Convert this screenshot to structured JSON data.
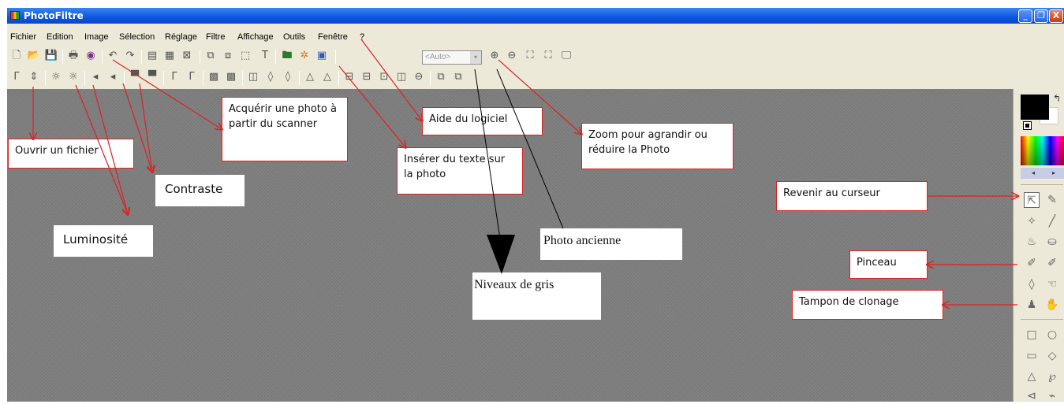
{
  "window": {
    "title": "PhotoFiltre",
    "minimize_label": "_",
    "maximize_label": "❐",
    "close_label": "X"
  },
  "menu": [
    "Fichier",
    "Edition",
    "Image",
    "Sélection",
    "Réglage",
    "Filtre",
    "Affichage",
    "Outils",
    "Fenêtre",
    "?"
  ],
  "toolbar": {
    "zoom_value": "<Auto>",
    "zoom_arrow": "▾"
  },
  "tool_panel": {
    "swap_glyph": "↰",
    "nav_left": "◂",
    "nav_right": "▸"
  },
  "annotations": {
    "ouvrir": "Ouvrir un fichier",
    "luminosite": "Luminosité",
    "contraste": "Contraste",
    "acquerir": "Acquérir une photo à partir du scanner",
    "inserer": "Insérer du texte sur la photo",
    "aide": "Aide du logiciel",
    "zoom": "Zoom pour agrandir ou réduire la Photo",
    "photo_ancienne": "Photo ancienne",
    "niveaux_gris": "Niveaux de gris",
    "revenir": "Revenir au curseur",
    "pinceau": "Pinceau",
    "tampon": "Tampon de clonage"
  },
  "colors": {
    "titlebar": "#0d55e0",
    "annotation_border": "#dd2222",
    "arrow": "#dd2222",
    "workspace": "#7e7e7e"
  }
}
